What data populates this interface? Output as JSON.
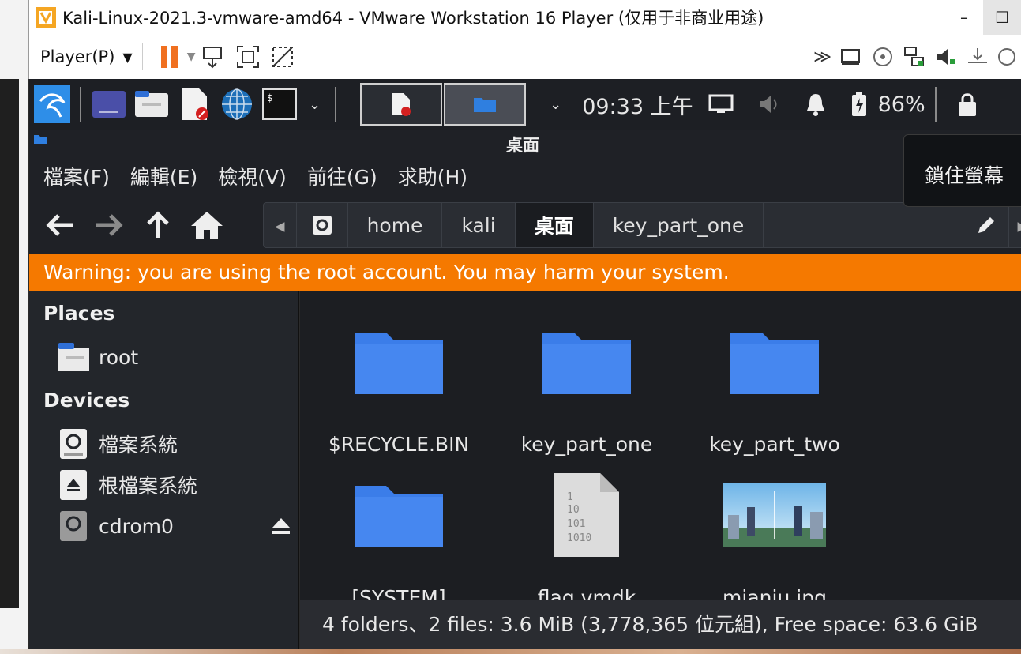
{
  "vmware": {
    "title": "Kali-Linux-2021.3-vmware-amd64 - VMware Workstation 16 Player (仅用于非商业用途)",
    "player_menu": "Player(P)",
    "minimize": "–",
    "maximize": "☐"
  },
  "kali_panel": {
    "clock": "09:33 上午",
    "battery": "86%"
  },
  "file_manager": {
    "title": "桌面",
    "menu": [
      "檔案(F)",
      "編輯(E)",
      "檢視(V)",
      "前往(G)",
      "求助(H)"
    ],
    "lock_tooltip": "鎖住螢幕",
    "breadcrumb": [
      "home",
      "kali",
      "桌面",
      "key_part_one"
    ],
    "warning": "Warning: you are using the root account. You may harm your system.",
    "sidebar": {
      "places_heading": "Places",
      "places": [
        {
          "label": "root",
          "icon": "home-folder-icon"
        }
      ],
      "devices_heading": "Devices",
      "devices": [
        {
          "label": "檔案系統",
          "icon": "drive-icon"
        },
        {
          "label": "根檔案系統",
          "icon": "removable-drive-icon"
        },
        {
          "label": "cdrom0",
          "icon": "optical-drive-icon"
        }
      ]
    },
    "items": [
      {
        "name": "$RECYCLE.BIN",
        "type": "folder"
      },
      {
        "name": "key_part_one",
        "type": "folder"
      },
      {
        "name": "key_part_two",
        "type": "folder"
      },
      {
        "name": "[SYSTEM]",
        "type": "folder"
      },
      {
        "name": "flag.vmdk",
        "type": "binary-file"
      },
      {
        "name": "mianju.jpg",
        "type": "image"
      }
    ],
    "status": "4 folders、2 files: 3.6 MiB (3,778,365 位元組), Free space: 63.6 GiB"
  },
  "colors": {
    "warning_bg": "#f57900",
    "folder_blue": "#3b7de9",
    "panel_bg": "#1d1f24"
  }
}
